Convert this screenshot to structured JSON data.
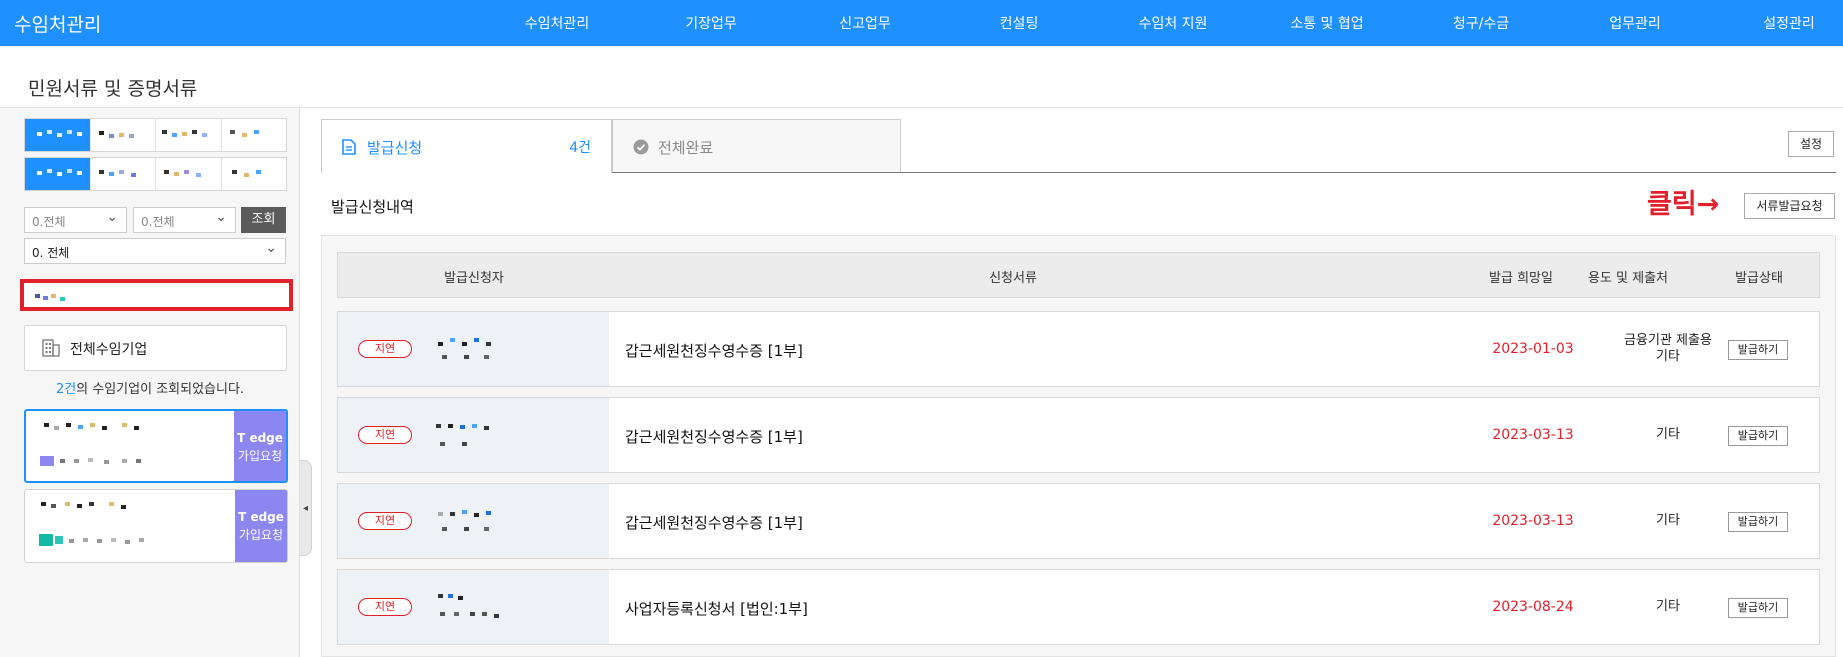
{
  "header": {
    "brand": "수임처관리",
    "nav": [
      "수임처관리",
      "기장업무",
      "신고업무",
      "컨설팅",
      "수임처 지원",
      "소통 및 협업",
      "청구/수금",
      "업무관리",
      "설정관리"
    ]
  },
  "page_title": "민원서류 및 증명서류",
  "filters": {
    "select1": "0.전체",
    "select2": "0.전체",
    "search_button": "조회",
    "select3": "0. 전체"
  },
  "left": {
    "all_companies": "전체수임기업",
    "count_number": "2건",
    "count_suffix": "의 수임기업이 조회되었습니다.",
    "cards": [
      {
        "badge_brand": "T edge",
        "badge_text": "가입요청"
      },
      {
        "badge_brand": "T edge",
        "badge_text": "가입요청"
      }
    ]
  },
  "tabs": {
    "request_label": "발급신청",
    "request_count": "4건",
    "complete_label": "전체완료"
  },
  "buttons": {
    "settings": "설정",
    "request_docs": "서류발급요청"
  },
  "section_title": "발급신청내역",
  "annotation": "클릭→",
  "table": {
    "headers": [
      "발급신청자",
      "신청서류",
      "발급 희망일",
      "용도 및 제출처",
      "발급상태"
    ],
    "rows": [
      {
        "status": "지연",
        "document": "갑근세원천징수영수증 [1부]",
        "date": "2023-01-03",
        "purpose": "금융기관 제출용\n기타",
        "action": "발급하기"
      },
      {
        "status": "지연",
        "document": "갑근세원천징수영수증 [1부]",
        "date": "2023-03-13",
        "purpose": "기타",
        "action": "발급하기"
      },
      {
        "status": "지연",
        "document": "갑근세원천징수영수증 [1부]",
        "date": "2023-03-13",
        "purpose": "기타",
        "action": "발급하기"
      },
      {
        "status": "지연",
        "document": "사업자등록신청서 [법인:1부]",
        "date": "2023-08-24",
        "purpose": "기타",
        "action": "발급하기"
      }
    ]
  },
  "colors": {
    "primary": "#1e90ff",
    "alert": "#e0202b",
    "badge": "#8c86f0"
  }
}
